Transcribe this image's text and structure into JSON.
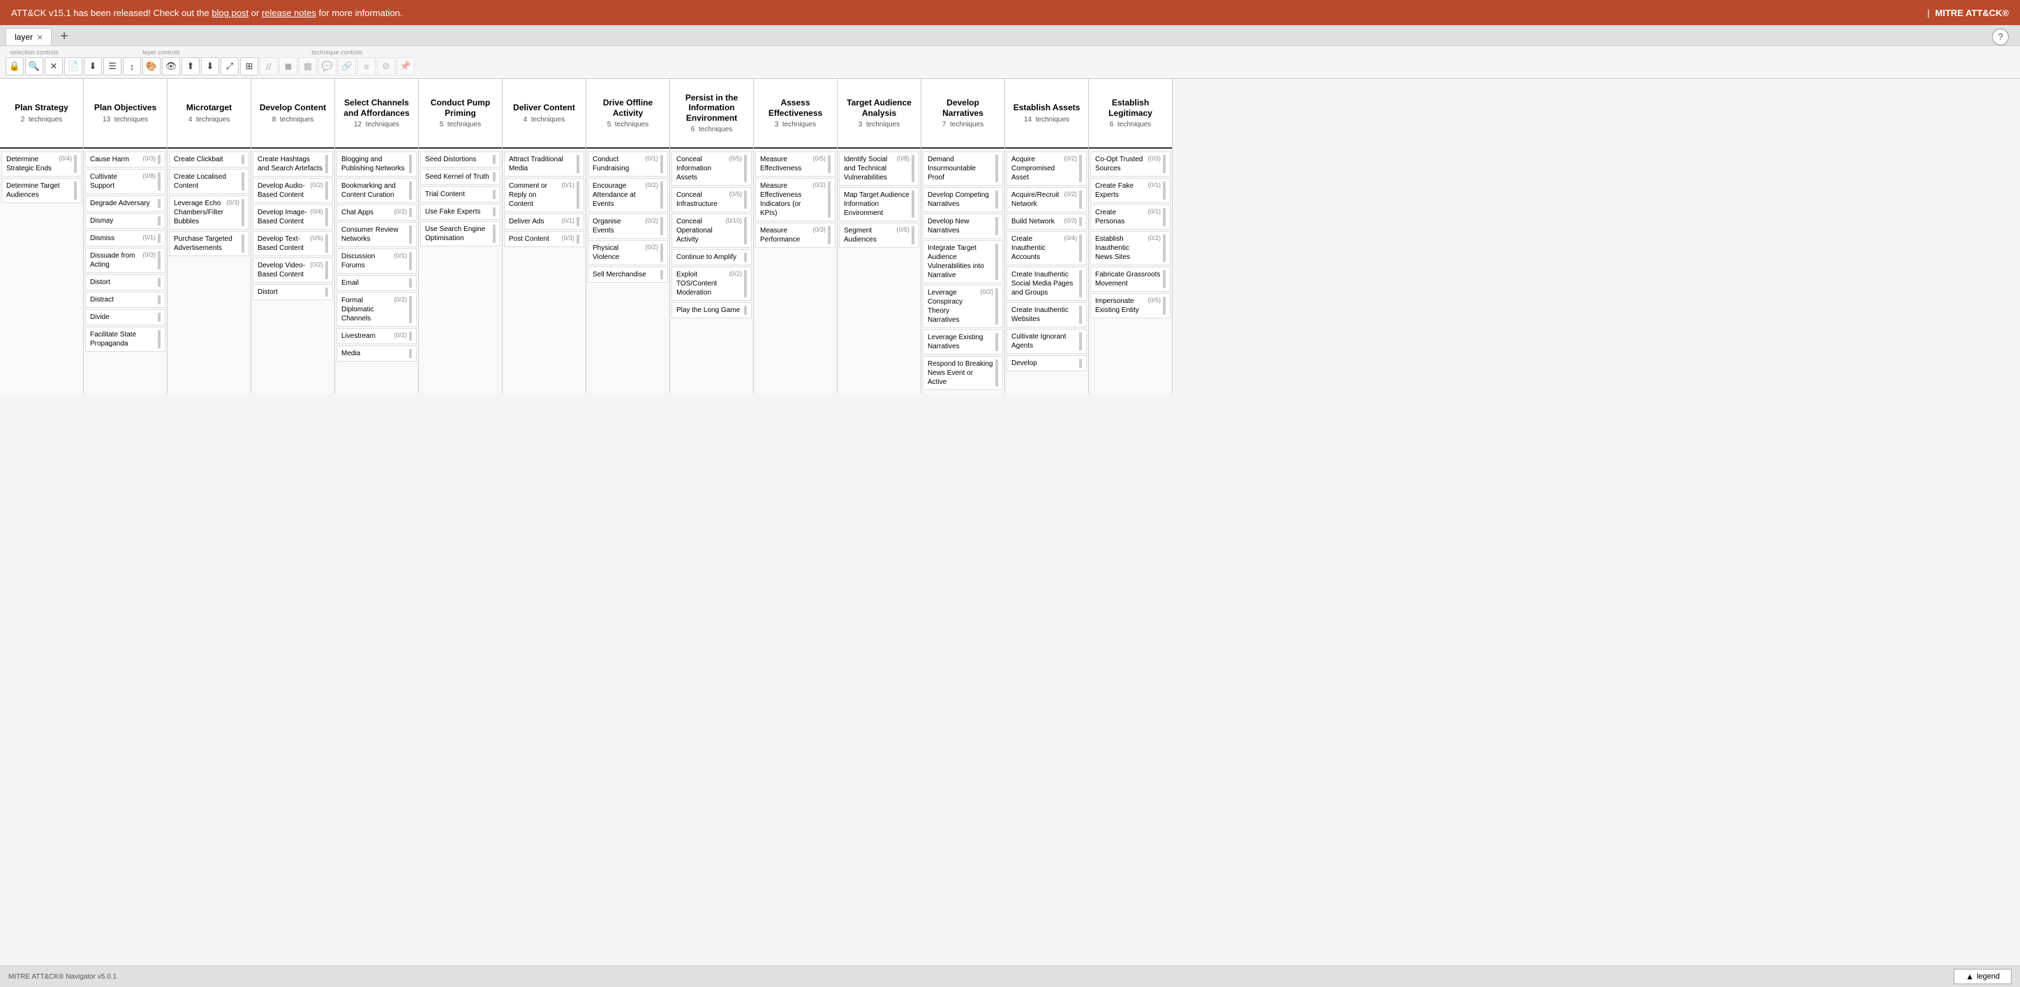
{
  "banner": {
    "text": "ATT&CK v15.1 has been released! Check out the ",
    "blog_post_label": "blog post",
    "or_label": " or ",
    "release_notes_label": "release notes",
    "suffix": " for more information.",
    "right_label": "MITRE ATT&CK®"
  },
  "tabbar": {
    "tab_label": "layer",
    "add_label": "+",
    "help_label": "?"
  },
  "toolbar": {
    "selection_controls_label": "selection controls",
    "layer_controls_label": "layer controls",
    "technique_controls_label": "technique controls"
  },
  "footer": {
    "version_label": "MITRE ATT&CK® Navigator v5.0.1",
    "legend_label": "legend"
  },
  "tactics": [
    {
      "id": "plan-strategy",
      "name": "Plan Strategy",
      "count": "2",
      "unit": "techniques",
      "techniques": [
        {
          "name": "Determine Strategic Ends",
          "score": "(0/4)"
        },
        {
          "name": "Determine Target Audiences",
          "score": ""
        }
      ]
    },
    {
      "id": "plan-objectives",
      "name": "Plan Objectives",
      "count": "13",
      "unit": "techniques",
      "techniques": [
        {
          "name": "Cause Harm",
          "score": "(0/3)"
        },
        {
          "name": "Cultivate Support",
          "score": "(0/8)"
        },
        {
          "name": "Degrade Adversary",
          "score": ""
        },
        {
          "name": "Dismay",
          "score": ""
        },
        {
          "name": "Dismiss",
          "score": "(0/1)"
        },
        {
          "name": "Dissuade from Acting",
          "score": "(0/3)"
        },
        {
          "name": "Distort",
          "score": ""
        },
        {
          "name": "Distract",
          "score": ""
        },
        {
          "name": "Divide",
          "score": ""
        },
        {
          "name": "Facilitate State Propaganda",
          "score": ""
        }
      ]
    },
    {
      "id": "microtarget",
      "name": "Microtarget",
      "count": "4",
      "unit": "techniques",
      "techniques": [
        {
          "name": "Create Clickbait",
          "score": ""
        },
        {
          "name": "Create Localised Content",
          "score": ""
        },
        {
          "name": "Leverage Echo Chambers/Filter Bubbles",
          "score": "(0/3)"
        },
        {
          "name": "Purchase Targeted Advertisements",
          "score": ""
        }
      ]
    },
    {
      "id": "develop-content",
      "name": "Develop Content",
      "count": "8",
      "unit": "techniques",
      "techniques": [
        {
          "name": "Create Hashtags and Search Artefacts",
          "score": ""
        },
        {
          "name": "Develop Audio-Based Content",
          "score": "(0/2)"
        },
        {
          "name": "Develop Image-Based Content",
          "score": "(0/4)"
        },
        {
          "name": "Develop Text-Based Content",
          "score": "(0/6)"
        },
        {
          "name": "Develop Video-Based Content",
          "score": "(0/2)"
        },
        {
          "name": "Distort",
          "score": ""
        }
      ]
    },
    {
      "id": "select-channels",
      "name": "Select Channels and Affordances",
      "count": "12",
      "unit": "techniques",
      "techniques": [
        {
          "name": "Blogging and Publishing Networks",
          "score": ""
        },
        {
          "name": "Bookmarking and Content Curation",
          "score": ""
        },
        {
          "name": "Chat Apps",
          "score": "(0/2)"
        },
        {
          "name": "Consumer Review Networks",
          "score": ""
        },
        {
          "name": "Discussion Forums",
          "score": "(0/1)"
        },
        {
          "name": "Email",
          "score": ""
        },
        {
          "name": "Formal Diplomatic Channels",
          "score": "(0/2)"
        },
        {
          "name": "Livestream",
          "score": "(0/2)"
        },
        {
          "name": "Media",
          "score": ""
        }
      ]
    },
    {
      "id": "conduct-pump-priming",
      "name": "Conduct Pump Priming",
      "count": "5",
      "unit": "techniques",
      "techniques": [
        {
          "name": "Seed Distortions",
          "score": ""
        },
        {
          "name": "Seed Kernel of Truth",
          "score": ""
        },
        {
          "name": "Trial Content",
          "score": ""
        },
        {
          "name": "Use Fake Experts",
          "score": ""
        },
        {
          "name": "Use Search Engine Optimisation",
          "score": ""
        }
      ]
    },
    {
      "id": "deliver-content",
      "name": "Deliver Content",
      "count": "4",
      "unit": "techniques",
      "techniques": [
        {
          "name": "Attract Traditional Media",
          "score": ""
        },
        {
          "name": "Comment or Reply on Content",
          "score": "(0/1)"
        },
        {
          "name": "Deliver Ads",
          "score": "(0/1)"
        },
        {
          "name": "Post Content",
          "score": "(0/3)"
        }
      ]
    },
    {
      "id": "drive-offline",
      "name": "Drive Offline Activity",
      "count": "5",
      "unit": "techniques",
      "techniques": [
        {
          "name": "Conduct Fundraising",
          "score": "(0/1)"
        },
        {
          "name": "Encourage Attendance at Events",
          "score": "(0/2)"
        },
        {
          "name": "Organise Events",
          "score": "(0/2)"
        },
        {
          "name": "Physical Violence",
          "score": "(0/2)"
        },
        {
          "name": "Sell Merchandise",
          "score": ""
        }
      ]
    },
    {
      "id": "persist-information",
      "name": "Persist in the Information Environment",
      "count": "6",
      "unit": "techniques",
      "techniques": [
        {
          "name": "Conceal Information Assets",
          "score": "(0/5)"
        },
        {
          "name": "Conceal Infrastructure",
          "score": "(0/5)"
        },
        {
          "name": "Conceal Operational Activity",
          "score": "(0/10)"
        },
        {
          "name": "Continue to Amplify",
          "score": ""
        },
        {
          "name": "Exploit TOS/Content Moderation",
          "score": "(0/2)"
        },
        {
          "name": "Play the Long Game",
          "score": ""
        }
      ]
    },
    {
      "id": "assess-effectiveness",
      "name": "Assess Effectiveness",
      "count": "3",
      "unit": "techniques",
      "techniques": [
        {
          "name": "Measure Effectiveness",
          "score": "(0/5)"
        },
        {
          "name": "Measure Effectiveness Indicators (or KPIs)",
          "score": "(0/2)"
        },
        {
          "name": "Measure Performance",
          "score": "(0/3)"
        }
      ]
    },
    {
      "id": "target-audience",
      "name": "Target Audience Analysis",
      "count": "3",
      "unit": "techniques",
      "techniques": [
        {
          "name": "Identify Social and Technical Vulnerabilities",
          "score": "(0/8)"
        },
        {
          "name": "Map Target Audience Information Environment",
          "score": ""
        },
        {
          "name": "Segment Audiences",
          "score": "(0/5)"
        }
      ]
    },
    {
      "id": "develop-narratives",
      "name": "Develop Narratives",
      "count": "7",
      "unit": "techniques",
      "techniques": [
        {
          "name": "Demand Insurmountable Proof",
          "score": ""
        },
        {
          "name": "Develop Competing Narratives",
          "score": ""
        },
        {
          "name": "Develop New Narratives",
          "score": ""
        },
        {
          "name": "Integrate Target Audience Vulnerabilities into Narrative",
          "score": ""
        },
        {
          "name": "Leverage Conspiracy Theory Narratives",
          "score": "(0/2)"
        },
        {
          "name": "Leverage Existing Narratives",
          "score": ""
        },
        {
          "name": "Respond to Breaking News Event or Active",
          "score": ""
        }
      ]
    },
    {
      "id": "establish-assets",
      "name": "Establish Assets",
      "count": "14",
      "unit": "techniques",
      "techniques": [
        {
          "name": "Acquire Compromised Asset",
          "score": "(0/2)"
        },
        {
          "name": "Acquire/Recruit Network",
          "score": "(0/2)"
        },
        {
          "name": "Build Network",
          "score": "(0/3)"
        },
        {
          "name": "Create Inauthentic Accounts",
          "score": "(0/4)"
        },
        {
          "name": "Create Inauthentic Social Media Pages and Groups",
          "score": ""
        },
        {
          "name": "Create Inauthentic Websites",
          "score": ""
        },
        {
          "name": "Cultivate Ignorant Agents",
          "score": ""
        },
        {
          "name": "Develop",
          "score": ""
        }
      ]
    },
    {
      "id": "establish-legitimacy",
      "name": "Establish Legitimacy",
      "count": "6",
      "unit": "techniques",
      "techniques": [
        {
          "name": "Co-Opt Trusted Sources",
          "score": "(0/3)"
        },
        {
          "name": "Create Fake Experts",
          "score": "(0/1)"
        },
        {
          "name": "Create Personas",
          "score": "(0/1)"
        },
        {
          "name": "Establish Inauthentic News Sites",
          "score": "(0/2)"
        },
        {
          "name": "Fabricate Grassroots Movement",
          "score": ""
        },
        {
          "name": "Impersonate Existing Entity",
          "score": "(0/5)"
        }
      ]
    }
  ]
}
